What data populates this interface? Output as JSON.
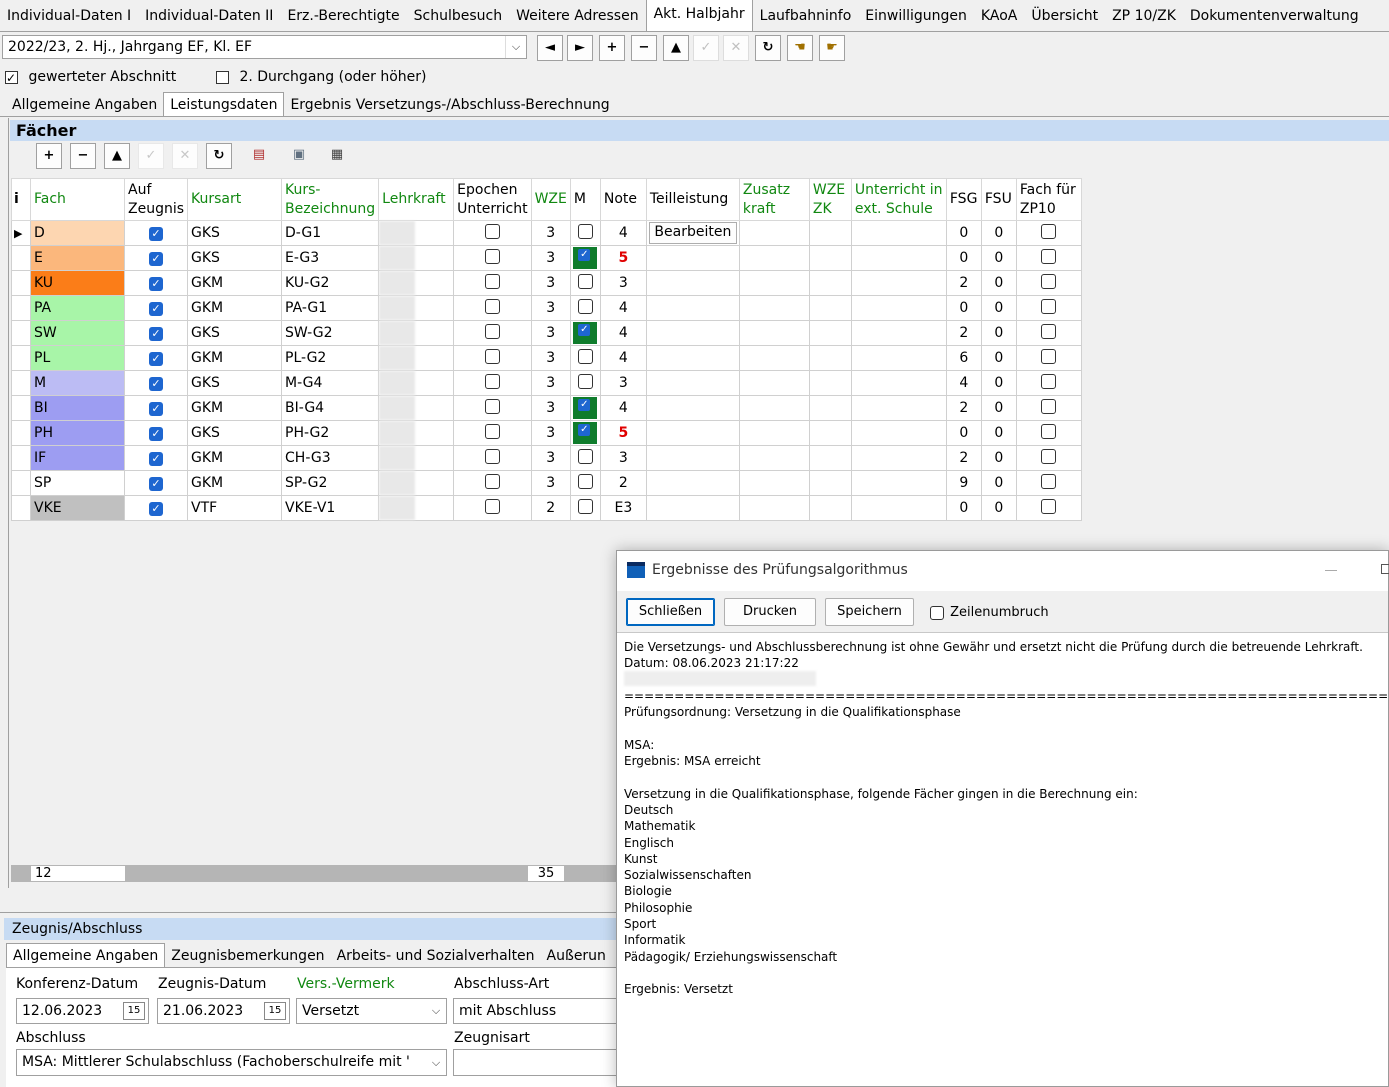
{
  "top_tabs": [
    "Individual-Daten I",
    "Individual-Daten II",
    "Erz.-Berechtigte",
    "Schulbesuch",
    "Weitere Adressen",
    "Akt. Halbjahr",
    "Laufbahninfo",
    "Einwilligungen",
    "KAoA",
    "Übersicht",
    "ZP 10/ZK",
    "Dokumentenverwaltung"
  ],
  "active_top_tab": "Akt. Halbjahr",
  "period_select": "2022/23, 2. Hj., Jahrgang EF, Kl. EF",
  "nav": {
    "prev": "◄",
    "next": "►",
    "add": "+",
    "remove": "−",
    "up": "▲",
    "ok": "✓",
    "cancel": "✕",
    "refresh": "↻"
  },
  "checks": {
    "gewertet": "gewerteter Abschnitt",
    "durchgang": "2. Durchgang (oder höher)"
  },
  "sub_tabs": [
    "Allgemeine Angaben",
    "Leistungsdaten",
    "Ergebnis Versetzungs-/Abschluss-Berechnung"
  ],
  "faecher_title": "Fächer",
  "table": {
    "headers": {
      "info": "i",
      "fach": "Fach",
      "zeugnis": "Auf Zeugnis",
      "kursart": "Kursart",
      "kursbez": "Kurs-Bezeichnung",
      "lehrkraft": "Lehrkraft",
      "epochen": "Epochen Unterricht",
      "wze": "WZE",
      "m": "M",
      "note": "Note",
      "teil": "Teilleistung",
      "zusatz": "Zusatz kraft",
      "wzezk": "WZE ZK",
      "ext": "Unterricht in ext. Schule",
      "fsg": "FSG",
      "fsu": "FSU",
      "zp10": "Fach für ZP10"
    },
    "edit_label": "Bearbeiten",
    "rows": [
      {
        "fach": "D",
        "color": "#fdd6b1",
        "kursart": "GKS",
        "bez": "D-G1",
        "wze": "3",
        "m": false,
        "note": "4",
        "red": false,
        "fsg": "0",
        "fsu": "0"
      },
      {
        "fach": "E",
        "color": "#fbb77c",
        "kursart": "GKS",
        "bez": "E-G3",
        "wze": "3",
        "m": true,
        "note": "5",
        "red": true,
        "fsg": "0",
        "fsu": "0"
      },
      {
        "fach": "KU",
        "color": "#fb7d18",
        "kursart": "GKM",
        "bez": "KU-G2",
        "wze": "3",
        "m": false,
        "note": "3",
        "red": false,
        "fsg": "2",
        "fsu": "0"
      },
      {
        "fach": "PA",
        "color": "#a8f5a8",
        "kursart": "GKM",
        "bez": "PA-G1",
        "wze": "3",
        "m": false,
        "note": "4",
        "red": false,
        "fsg": "0",
        "fsu": "0"
      },
      {
        "fach": "SW",
        "color": "#a8f5a8",
        "kursart": "GKS",
        "bez": "SW-G2",
        "wze": "3",
        "m": true,
        "note": "4",
        "red": false,
        "fsg": "2",
        "fsu": "0"
      },
      {
        "fach": "PL",
        "color": "#a8f5a8",
        "kursart": "GKM",
        "bez": "PL-G2",
        "wze": "3",
        "m": false,
        "note": "4",
        "red": false,
        "fsg": "6",
        "fsu": "0"
      },
      {
        "fach": "M",
        "color": "#bcbcf4",
        "kursart": "GKS",
        "bez": "M-G4",
        "wze": "3",
        "m": false,
        "note": "3",
        "red": false,
        "fsg": "4",
        "fsu": "0"
      },
      {
        "fach": "BI",
        "color": "#9d9df2",
        "kursart": "GKM",
        "bez": "BI-G4",
        "wze": "3",
        "m": true,
        "note": "4",
        "red": false,
        "fsg": "2",
        "fsu": "0"
      },
      {
        "fach": "PH",
        "color": "#9d9df2",
        "kursart": "GKS",
        "bez": "PH-G2",
        "wze": "3",
        "m": true,
        "note": "5",
        "red": true,
        "fsg": "0",
        "fsu": "0"
      },
      {
        "fach": "IF",
        "color": "#9d9df2",
        "kursart": "GKM",
        "bez": "CH-G3",
        "wze": "3",
        "m": false,
        "note": "3",
        "red": false,
        "fsg": "2",
        "fsu": "0"
      },
      {
        "fach": "SP",
        "color": "#ffffff",
        "kursart": "GKM",
        "bez": "SP-G2",
        "wze": "3",
        "m": false,
        "note": "2",
        "red": false,
        "fsg": "9",
        "fsu": "0"
      },
      {
        "fach": "VKE",
        "color": "#c0c0c0",
        "kursart": "VTF",
        "bez": "VKE-V1",
        "wze": "2",
        "m": false,
        "note": "E3",
        "red": false,
        "fsg": "0",
        "fsu": "0"
      }
    ]
  },
  "footer_counts": {
    "count": "12",
    "wze_sum": "35"
  },
  "zeugnis": {
    "title": "Zeugnis/Abschluss",
    "tabs": [
      "Allgemeine Angaben",
      "Zeugnisbemerkungen",
      "Arbeits- und Sozialverhalten",
      "Außerun"
    ],
    "konferenz_label": "Konferenz-Datum",
    "konferenz_value": "12.06.2023",
    "zeugnisdatum_label": "Zeugnis-Datum",
    "zeugnisdatum_value": "21.06.2023",
    "vers_label": "Vers.-Vermerk",
    "vers_value": "Versetzt",
    "art_label": "Abschluss-Art",
    "art_value": "mit Abschluss",
    "abschluss_label": "Abschluss",
    "abschluss_value": "MSA: Mittlerer Schulabschluss (Fachoberschulreife mit '",
    "zeugnisart_label": "Zeugnisart",
    "zeugnisart_value": ""
  },
  "dialog": {
    "title": "Ergebnisse des Prüfungsalgorithmus",
    "close": "Schließen",
    "print": "Drucken",
    "save": "Speichern",
    "wrap": "Zeilenumbruch",
    "lines": [
      "Die Versetzungs- und Abschlussberechnung ist ohne Gewähr und ersetzt nicht die Prüfung durch die betreuende Lehrkraft.",
      "Datum: 08.06.2023 21:17:22",
      "",
      "============================================================================",
      "Prüfungsordnung: Versetzung in die Qualifikationsphase",
      "",
      "MSA:",
      "Ergebnis: MSA erreicht",
      "",
      "Versetzung in die Qualifikationsphase, folgende Fächer gingen in die Berechnung ein:",
      "Deutsch",
      "Mathematik",
      "Englisch",
      "Kunst",
      "Sozialwissenschaften",
      "Biologie",
      "Philosophie",
      "Sport",
      "Informatik",
      "Pädagogik/ Erziehungswissenschaft",
      "",
      "Ergebnis: Versetzt"
    ]
  },
  "colors": {
    "panel_head": "#c7dbf3",
    "green_header": "#118811",
    "m_green": "#0f7c2c",
    "checkbox_blue": "#1e66d0",
    "red_note": "#e00000"
  }
}
